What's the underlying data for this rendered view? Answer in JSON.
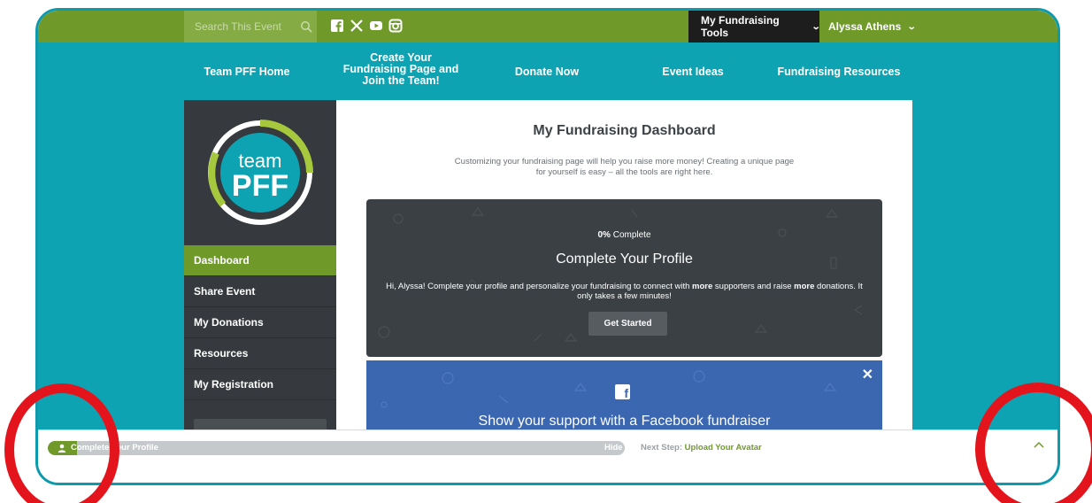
{
  "topbar": {
    "search_placeholder": "Search This Event",
    "social_icons": [
      "facebook-icon",
      "x-icon",
      "youtube-icon",
      "instagram-icon"
    ],
    "tools_label": "My Fundraising Tools",
    "user_label": "Alyssa Athens"
  },
  "nav": {
    "items": [
      "Team PFF Home",
      "Create Your Fundraising Page and Join the Team!",
      "Donate Now",
      "Event Ideas",
      "Fundraising Resources"
    ]
  },
  "sidebar": {
    "logo_text_top": "team",
    "logo_text_bottom": "PFF",
    "items": [
      {
        "label": "Dashboard",
        "active": true
      },
      {
        "label": "Share Event",
        "active": false
      },
      {
        "label": "My Donations",
        "active": false
      },
      {
        "label": "Resources",
        "active": false
      },
      {
        "label": "My Registration",
        "active": false
      }
    ]
  },
  "main": {
    "title": "My Fundraising Dashboard",
    "subtitle": "Customizing your fundraising page will help you raise more money! Creating a unique page for yourself is easy – all the tools are right here."
  },
  "profile_card": {
    "percent": "0%",
    "percent_suffix": " Complete",
    "title": "Complete Your Profile",
    "text_1": "Hi, Alyssa! Complete your profile and personalize your fundraising to connect with ",
    "text_bold_1": "more",
    "text_2": " supporters and raise ",
    "text_bold_2": "more",
    "text_3": " donations. It only takes a few minutes!",
    "button": "Get Started"
  },
  "facebook_card": {
    "close": "✕",
    "icon_letter": "f",
    "text": "Show your support with a Facebook fundraiser"
  },
  "progress_bar": {
    "label": "Complete Your Profile",
    "hide": "Hide",
    "next_step_prefix": "Next Step: ",
    "next_step_link": "Upload Your Avatar",
    "fill_fraction": 0.05
  },
  "colors": {
    "brand_green": "#6f9a2a",
    "brand_teal": "#0ea3b2",
    "sidebar_dark": "#363a3e",
    "card_dark": "#3b4044",
    "facebook_blue": "#3b66b0",
    "annotation_red": "#e3141b"
  }
}
